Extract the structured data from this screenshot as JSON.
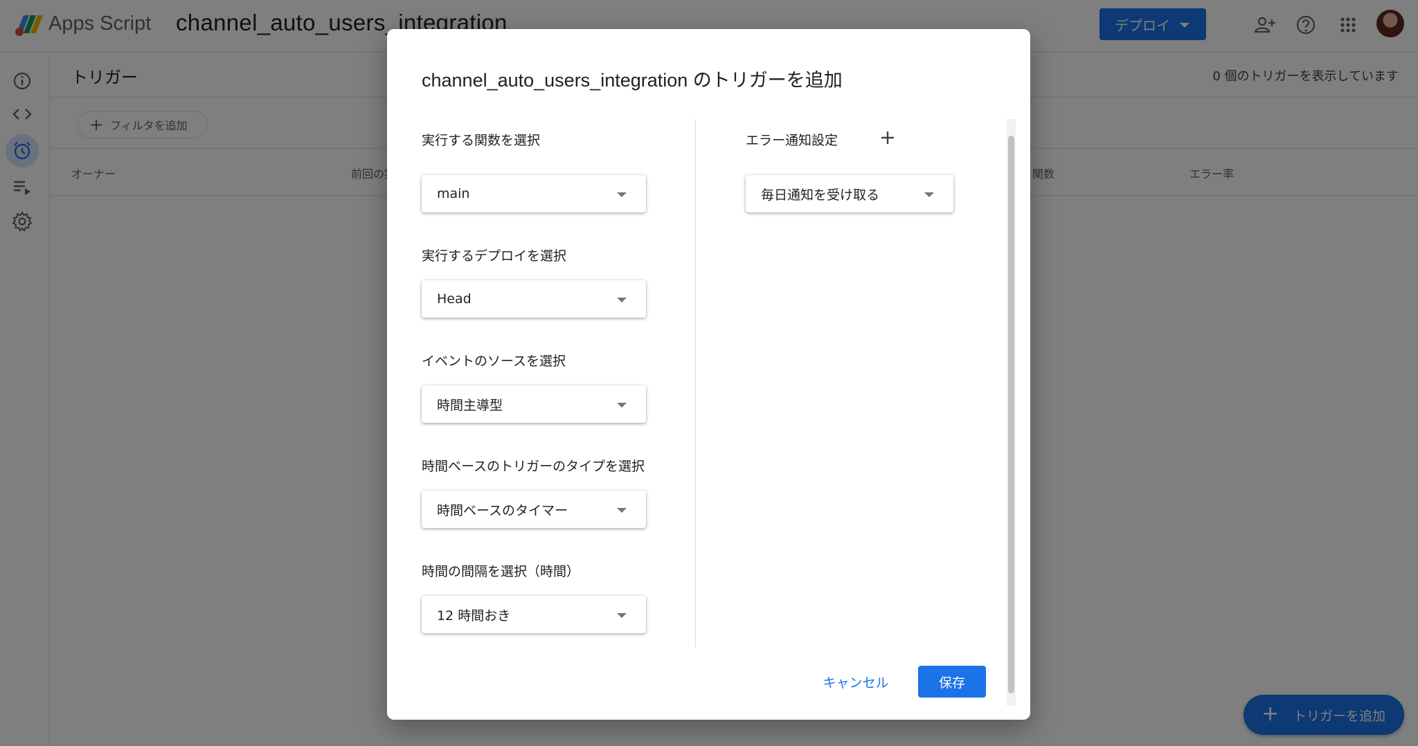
{
  "header": {
    "app_name": "Apps Script",
    "project_name": "channel_auto_users_integration",
    "deploy_label": "デプロイ"
  },
  "page": {
    "title": "トリガー",
    "trigger_count_text": "0 個のトリガーを表示しています",
    "filter_label": "フィルタを追加",
    "columns": [
      "オーナー",
      "前回の実",
      "関数",
      "エラー率"
    ]
  },
  "fab": {
    "label": "トリガーを追加"
  },
  "dialog": {
    "title": "channel_auto_users_integration のトリガーを追加",
    "fields": [
      {
        "label": "実行する関数を選択",
        "value": "main"
      },
      {
        "label": "実行するデプロイを選択",
        "value": "Head"
      },
      {
        "label": "イベントのソースを選択",
        "value": "時間主導型"
      },
      {
        "label": "時間ベースのトリガーのタイプを選択",
        "value": "時間ベースのタイマー"
      },
      {
        "label": "時間の間隔を選択（時間）",
        "value": "12 時間おき"
      }
    ],
    "error_notification": {
      "label": "エラー通知設定",
      "value": "毎日通知を受け取る"
    },
    "cancel_label": "キャンセル",
    "save_label": "保存"
  },
  "colors": {
    "primary": "#1a73e8",
    "scrim": "rgba(0,0,0,0.5)",
    "active_nav_bg": "#d2e3fc"
  },
  "icons": [
    "apps-script-logo",
    "info-icon",
    "code-icon",
    "alarm-clock-icon",
    "executions-icon",
    "settings-gear-icon",
    "add-person-icon",
    "help-icon",
    "apps-grid-icon",
    "plus-icon",
    "chevron-down-icon"
  ]
}
